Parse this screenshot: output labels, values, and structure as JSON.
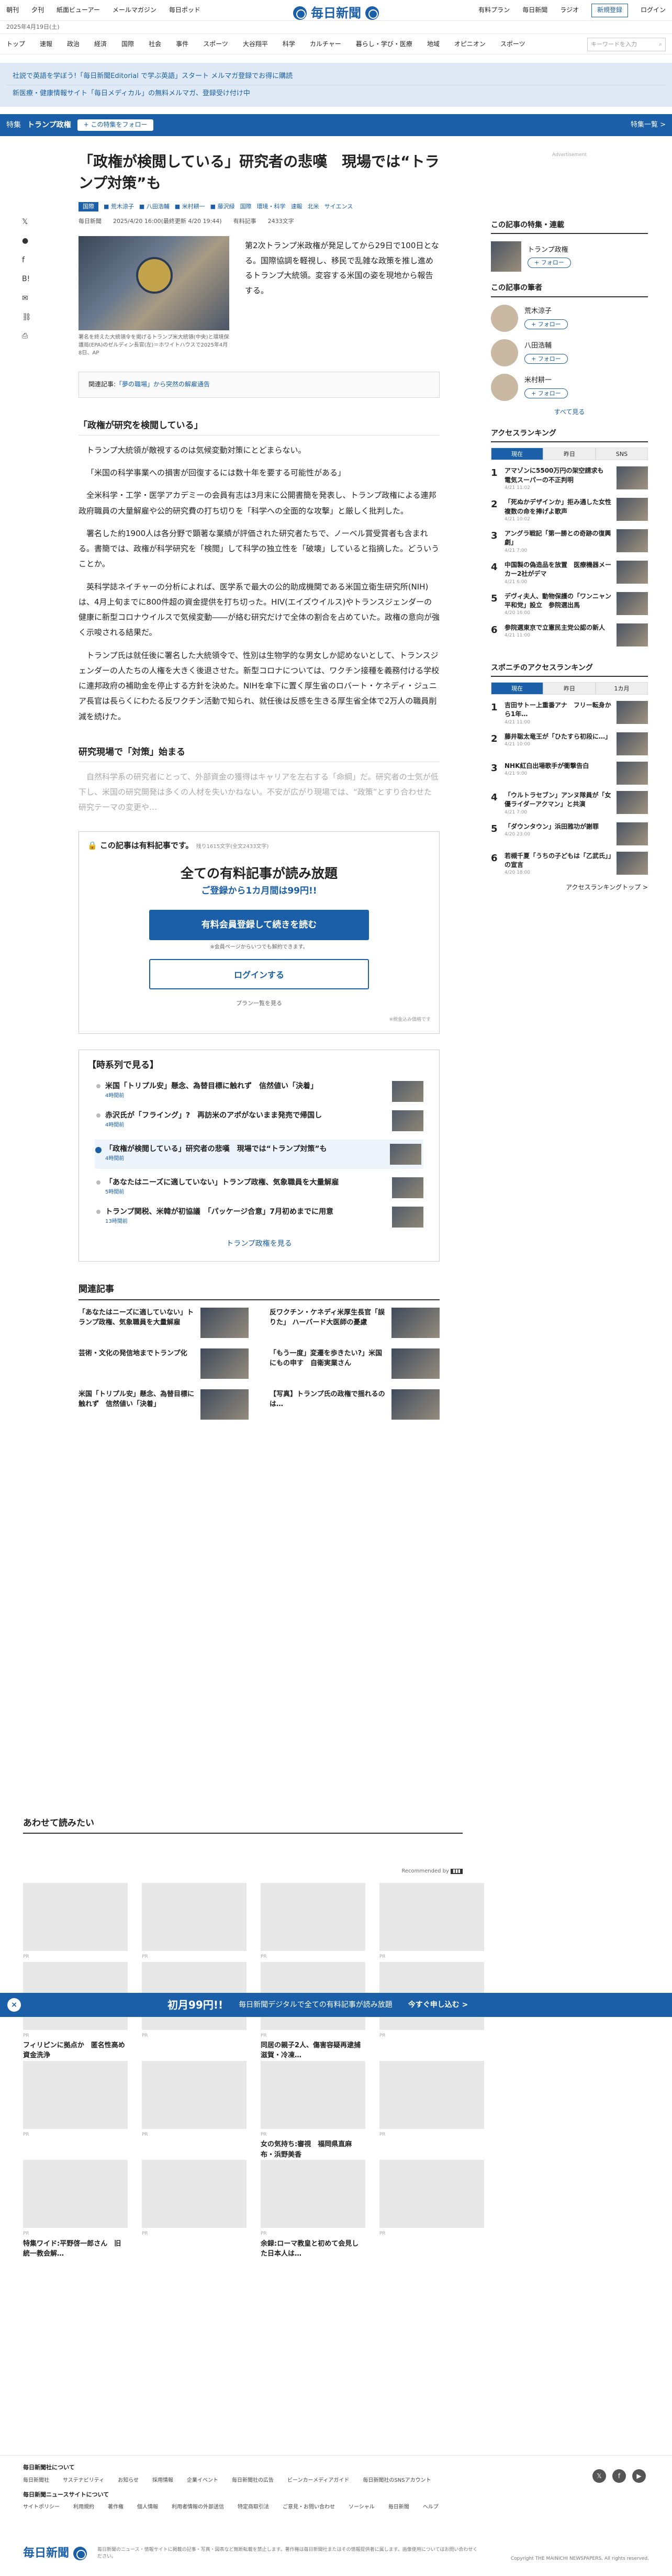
{
  "util": {
    "links": [
      "朝刊",
      "夕刊",
      "紙面ビューアー",
      "メールマガジン",
      "毎日ポッド"
    ],
    "right": [
      "有料プラン",
      "毎日新聞",
      "ラジオ"
    ],
    "register": "新規登録",
    "login": "ログイン"
  },
  "logo": "毎日新聞",
  "date": "2025年4月19日(土)",
  "nav": [
    "トップ",
    "速報",
    "政治",
    "経済",
    "国際",
    "社会",
    "事件",
    "スポーツ",
    "大谷翔平",
    "科学",
    "カルチャー",
    "暮らし・学び・医療",
    "地域",
    "オピニオン",
    "スポーツ"
  ],
  "search_placeholder": "キーワードを入力",
  "ads": [
    "社説で英語を学ぼう!「毎日新聞Editorial で学ぶ英語」スタート メルマガ登録でお得に購読",
    "新医療・健康情報サイト「毎日メディカル」の無料メルマガ、登録受け付け中"
  ],
  "feature": {
    "label": "特集",
    "name": "トランプ政権",
    "follow": "+ この特集をフォロー",
    "list": "特集一覧 >"
  },
  "article": {
    "title": "「政権が検閲している」研究者の悲嘆　現場では“トランプ対策”も",
    "tag": "国際",
    "authors": [
      "荒木涼子",
      "八田浩輔",
      "米村耕一",
      "藤沢緑"
    ],
    "topics": [
      "国際",
      "環境・科学",
      "速報",
      "北米",
      "サイエンス"
    ],
    "meta": [
      "毎日新聞",
      "2025/4/20 16:00(最終更新 4/20 19:44)",
      "有料記事",
      "2433文字"
    ],
    "caption": "署名を終えた大統領令を掲げるトランプ米大統領(中央)と環境保護局(EPA)のゼルディン長官(左)＝ホワイトハウスで2025年4月8日、AP",
    "lead": "第2次トランプ米政権が発足してから29日で100日となる。国際協調を軽視し、移民で乱雑な政策を推し進めるトランプ大統領。変容する米国の姿を現地から報告する。",
    "related_label": "関連記事:",
    "related_title": "「夢の職場」から突然の解雇通告",
    "h1": "「政権が研究を検閲している」",
    "paras": [
      "トランプ大統領が敵視するのは気候変動対策にとどまらない。",
      "「米国の科学事業への損害が回復するには数十年を要する可能性がある」",
      "全米科学・工学・医学アカデミーの会員有志は3月末に公開書簡を発表し、トランプ政権による連邦政府職員の大量解雇や公的研究費の打ち切りを「科学への全面的な攻撃」と厳しく批判した。",
      "署名した約1900人は各分野で顕著な業績が評価された研究者たちで、ノーベル賞受賞者も含まれる。書簡では、政権が科学研究を「検閲」して科学の独立性を「破壊」していると指摘した。どういうことか。",
      "英科学誌ネイチャーの分析によれば、医学系で最大の公的助成機関である米国立衛生研究所(NIH)は、4月上旬までに800件超の資金提供を打ち切った。HIV(エイズウイルス)やトランスジェンダーの健康に新型コロナウイルスで気候変動――が絡む研究だけで全体の割合を占めていた。政権の意向が強く示唆される結果だ。",
      "トランプ氏は就任後に署名した大統領令で、性別は生物学的な男女しか認めないとして、トランスジェンダーの人たちの人権を大きく後退させた。新型コロナについては、ワクチン接種を義務付ける学校に連邦政府の補助金を停止する方針を決めた。NIHを傘下に置く厚生省のロバート・ケネディ・ジュニア長官は長らくにわたる反ワクチン活動で知られ、就任後は反感を生きる厚生省全体で2万人の職員削減を続けた。"
    ],
    "h2": "研究現場で「対策」始まる",
    "fade": "自然科学系の研究者にとって、外部資金の獲得はキャリアを左右する「命綱」だ。研究者の士気が低下し、米国の研究開発は多くの人材を失いかねない。不安が広がり現場では、“政策”とすり合わせた研究テーマの変更や…"
  },
  "paywall": {
    "tag": "この記事は有料記事です。",
    "remain": "残り1615文字(全文2433文字)",
    "head": "全ての有料記事が読み放題",
    "sub": "ご登録から1カ月間は99円!!",
    "btn1": "有料会員登録して続きを読む",
    "note": "※会員ページからいつでも解約できます。",
    "btn2": "ログインする",
    "plan": "プラン一覧を見る",
    "note2": "※税金込み価格です"
  },
  "timeline": {
    "title": "【時系列で見る】",
    "items": [
      {
        "t": "米国「トリプル安」懸念、為替目標に触れず　信然値い「決着」",
        "d": "4時間前"
      },
      {
        "t": "赤沢氏が「フライング」?　再訪米のアポがないまま発売で帰国し",
        "d": "4時間前"
      },
      {
        "t": "「政権が検閲している」研究者の悲嘆　現場では“トランプ対策”も",
        "d": "4時間前"
      },
      {
        "t": "「あなたはニーズに適していない」トランプ政権、気象職員を大量解雇",
        "d": "5時間前"
      },
      {
        "t": "トランプ関税、米韓が初協議　「パッケージ合意」7月初めまでに用意",
        "d": "13時間前"
      }
    ],
    "more": "トランプ政権を見る"
  },
  "related": {
    "title": "関連記事",
    "items": [
      "「あなたはニーズに適していない」トランプ政権、気象職員を大量解雇",
      "反ワクチン・ケネディ米厚生長官「誤りた」 ハーバード大医師の憂慮",
      "芸術・文化の発信地までトランプ化",
      "「もう一度」変遷を歩きたい?」米国にもの申す　自衛実業さん",
      "米国「トリプル安」懸念、為替目標に触れず　信然値い「決着」",
      "【写真】トランプ氏の政権で揺れるのは…"
    ]
  },
  "read": {
    "title": "あわせて読みたい",
    "recby": "Recommended by",
    "items": [
      "",
      "",
      "",
      "",
      "フィリピンに拠点か　匿名性高め資金洗浄",
      "",
      "同居の親子2人、傷害容疑再逮捕　滋賀・冷凍…",
      "",
      "",
      "",
      "女の気持ち:審視　福岡県直麻布・浜野美香",
      "",
      "特集ワイド:平野啓一郎さん　旧統一教会解…",
      "",
      "余録:ローマ教皇と初めて会見した日本人は…",
      ""
    ],
    "pr": "PR"
  },
  "banner": {
    "lead": "初月99円!!",
    "text": "毎日新聞デジタルで全ての有料記事が読み放題",
    "cta": "今すぐ申し込む >"
  },
  "side": {
    "ad": "Advertisement",
    "s1": "この記事の特集・連載",
    "s1item": "トランプ政権",
    "follow": "+ フォロー",
    "s2": "この記事の筆者",
    "writers": [
      "荒木涼子",
      "八田浩輔",
      "米村耕一"
    ],
    "more": "すべて見る",
    "s3": "アクセスランキング",
    "tabs1": [
      "現在",
      "昨日",
      "SNS"
    ],
    "rank1": [
      {
        "t": "アマゾンに5500万円の架空請求も　電気スーパーの不正判明",
        "d": "4/21 11:02"
      },
      {
        "t": "「死ぬかデザインか」拒み通した女性　複数の命を捧げよ歌声",
        "d": "4/21 10:02"
      },
      {
        "t": "アングラ戦記「第一勝との奇跡の復興劇」",
        "d": "4/21 7:00"
      },
      {
        "t": "中国製の偽造品を放置　医療機器メーカー2社がデマ",
        "d": "4/21 6:00"
      },
      {
        "t": "デヴィ夫人、動物保護の「ワンニャン平和党」設立　参院選出馬",
        "d": "4/20 16:00"
      },
      {
        "t": "参院選東京で立憲民主党公認の新人",
        "d": "4/21 11:00"
      }
    ],
    "s4": "スポニチのアクセスランキング",
    "tabs2": [
      "現在",
      "昨日",
      "1カ月"
    ],
    "rank2": [
      {
        "t": "吉田サトー上重番アナ　フリー転身から1年…",
        "d": "4/21 11:00"
      },
      {
        "t": "藤井聡太竜王が「ひたすら初段に…」",
        "d": "4/21 10:00"
      },
      {
        "t": "NHK紅白出場歌手が衝撃告白",
        "d": "4/21 9:00"
      },
      {
        "t": "「ウルトラセブン」アンヌ隊員が「女優ライダーアクマン」と共演",
        "d": "4/21 7:00"
      },
      {
        "t": "「ダウンタウン」浜田雅功が謝罪",
        "d": "4/20 23:00"
      },
      {
        "t": "若槻千夏「うちの子どもは「乙武氏」」の宣言",
        "d": "4/20 18:00"
      }
    ],
    "s4more": "アクセスランキングトップ >"
  },
  "footer": {
    "h1": "毎日新聞社について",
    "l1": [
      "毎日新聞社",
      "サステナビリティ",
      "お知らせ",
      "採用情報",
      "企業イベント",
      "毎日新聞社の広告",
      "ビーンカーメディアガイド",
      "毎日新聞社のSNSアカウント"
    ],
    "h2": "毎日新聞ニュースサイトについて",
    "l2": [
      "サイトポリシー",
      "利用規約",
      "著作権",
      "個人情報",
      "利用者情報の外部送信",
      "特定商取引法",
      "ご意見・お問い合わせ",
      "ソーシャル",
      "毎日新聞",
      "ヘルプ"
    ],
    "copy_text": "毎日新聞のニュース・情報サイトに掲載の記事・写真・図表など無断転載を禁止します。著作権は毎日新聞社またはその情報提供者に属します。画像使用についてはお問い合わせください。",
    "copy": "Copyright THE MAINICHI NEWSPAPERS. All rights reserved."
  }
}
